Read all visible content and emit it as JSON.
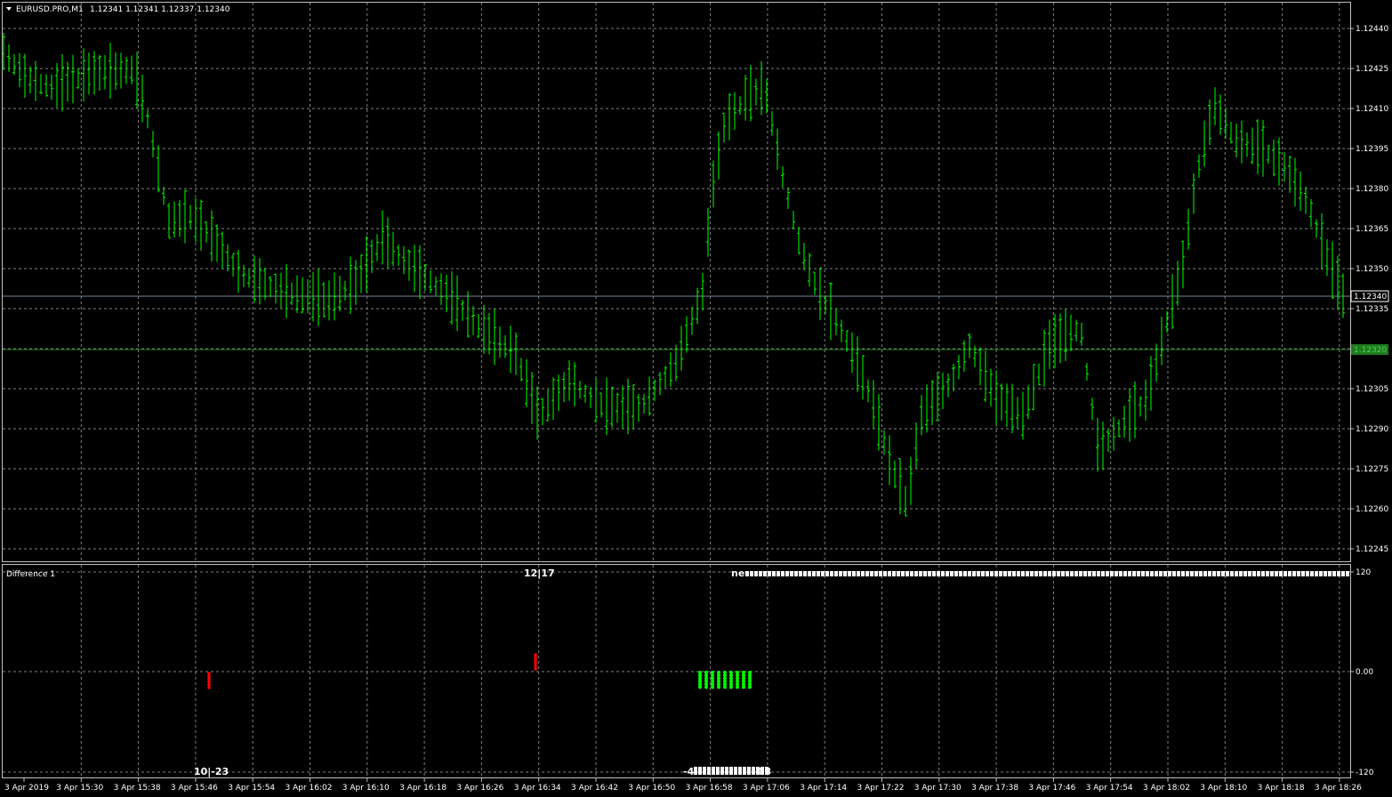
{
  "header": {
    "symbol": "EURUSD.PRO,M1",
    "ohlc": "1.12341 1.12341 1.12337 1.12340",
    "triangle_icon": "triangle-down-icon"
  },
  "main_chart": {
    "price_ticks": [
      "1.12440",
      "1.12425",
      "1.12410",
      "1.12395",
      "1.12380",
      "1.12365",
      "1.12350",
      "1.12335",
      "1.12320",
      "1.12305",
      "1.12290",
      "1.12275",
      "1.12260",
      "1.12245"
    ],
    "bid_label": "1.12340",
    "level_label": "1.12320",
    "bar_color": "#00ff00",
    "grid_color": "#7f7f7f"
  },
  "indicator": {
    "title": "Difference 1",
    "ticks": [
      "120",
      "0.00",
      "-120"
    ],
    "label_top_left": "12|17",
    "label_bottom_left": "10|-23",
    "label_top_right": "ne",
    "label_bottom_mid": "-4",
    "label_bottom_mid_tail": "03",
    "up_color": "#00ff00",
    "down_color": "#ff0000"
  },
  "time_axis": [
    "3 Apr 2019",
    "3 Apr 15:30",
    "3 Apr 15:38",
    "3 Apr 15:46",
    "3 Apr 15:54",
    "3 Apr 16:02",
    "3 Apr 16:10",
    "3 Apr 16:18",
    "3 Apr 16:26",
    "3 Apr 16:34",
    "3 Apr 16:42",
    "3 Apr 16:50",
    "3 Apr 16:58",
    "3 Apr 17:06",
    "3 Apr 17:14",
    "3 Apr 17:22",
    "3 Apr 17:30",
    "3 Apr 17:38",
    "3 Apr 17:46",
    "3 Apr 17:54",
    "3 Apr 18:02",
    "3 Apr 18:10",
    "3 Apr 18:18",
    "3 Apr 18:26"
  ]
}
